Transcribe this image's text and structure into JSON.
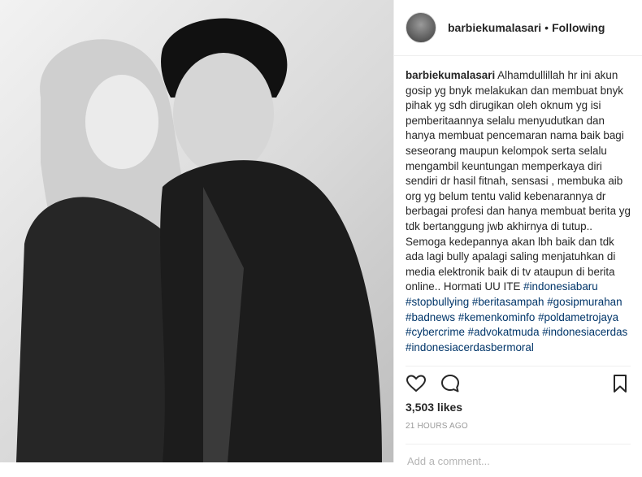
{
  "post": {
    "username": "barbiekumalasari",
    "separator": "•",
    "follow_status": "Following",
    "caption_text": "Alhamdullillah hr ini akun gosip yg bnyk melakukan dan membuat bnyk pihak yg sdh dirugikan oleh oknum yg isi pemberitaannya selalu menyudutkan dan hanya membuat pencemaran nama baik bagi seseorang maupun kelompok serta selalu mengambil keuntungan memperkaya diri sendiri dr hasil fitnah, sensasi , membuka aib org yg belum tentu valid kebenarannya dr berbagai profesi dan hanya membuat berita yg tdk bertanggung jwb akhirnya di tutup.. Semoga kedepannya akan lbh baik dan tdk ada lagi bully apalagi saling menjatuhkan di media elektronik baik di tv ataupun di berita online.. Hormati UU ITE",
    "hashtags": [
      "#indonesiabaru",
      "#stopbullying",
      "#beritasampah",
      "#gosipmurahan",
      "#badnews",
      "#kemenkominfo",
      "#poldametrojaya",
      "#cybercrime",
      "#advokatmuda",
      "#indonesiacerdas",
      "#indonesiacerdasbermoral"
    ],
    "likes": "3,503 likes",
    "time_ago": "21 HOURS AGO",
    "comment_placeholder": "Add a comment..."
  },
  "icons": {
    "like": "heart-outline-icon",
    "comment": "speech-bubble-icon",
    "save": "bookmark-icon"
  },
  "colors": {
    "text": "#262626",
    "hashtag": "#003569",
    "muted": "#999999",
    "divider": "#efefef"
  }
}
